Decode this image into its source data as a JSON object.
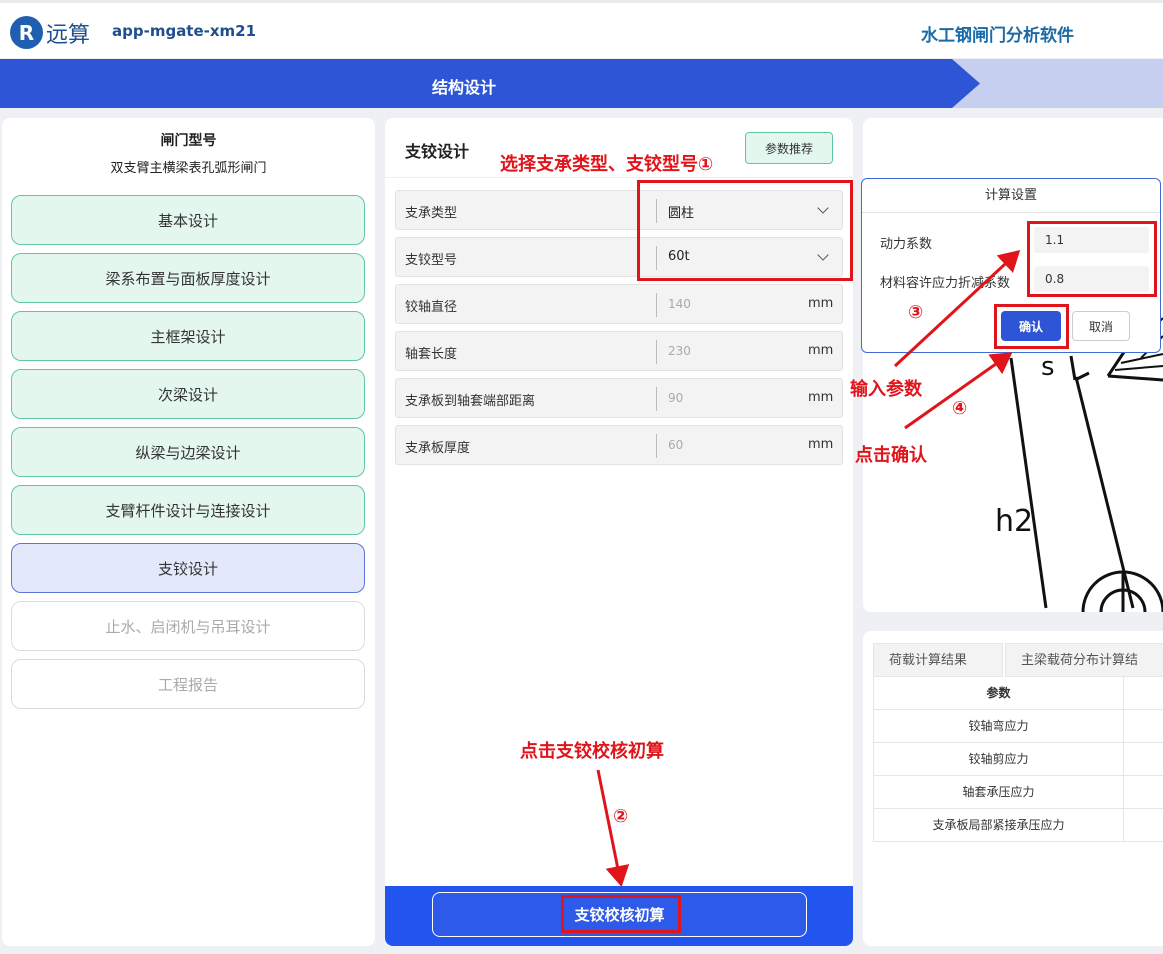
{
  "header": {
    "logo_mark": "R",
    "logo_text": "远算",
    "app_id": "app-mgate-xm21",
    "app_title": "水工钢闸门分析软件"
  },
  "stepbar": {
    "active_step": "结构设计"
  },
  "left": {
    "gate_type_label": "闸门型号",
    "gate_type_value": "双支臂主横梁表孔弧形闸门",
    "menu": [
      {
        "label": "基本设计",
        "state": "normal"
      },
      {
        "label": "梁系布置与面板厚度设计",
        "state": "normal"
      },
      {
        "label": "主框架设计",
        "state": "normal"
      },
      {
        "label": "次梁设计",
        "state": "normal"
      },
      {
        "label": "纵梁与边梁设计",
        "state": "normal"
      },
      {
        "label": "支臂杆件设计与连接设计",
        "state": "normal"
      },
      {
        "label": "支铰设计",
        "state": "active"
      },
      {
        "label": "止水、启闭机与吊耳设计",
        "state": "disabled"
      },
      {
        "label": "工程报告",
        "state": "disabled"
      }
    ]
  },
  "mid": {
    "title": "支铰设计",
    "recommend_label": "参数推荐",
    "fields": [
      {
        "label": "支承类型",
        "value": "圆柱",
        "kind": "select"
      },
      {
        "label": "支铰型号",
        "value": "60t",
        "kind": "select"
      },
      {
        "label": "铰轴直径",
        "value": "140",
        "unit": "mm",
        "kind": "readonly"
      },
      {
        "label": "轴套长度",
        "value": "230",
        "unit": "mm",
        "kind": "readonly"
      },
      {
        "label": "支承板到轴套端部距离",
        "value": "90",
        "unit": "mm",
        "kind": "readonly"
      },
      {
        "label": "支承板厚度",
        "value": "60",
        "unit": "mm",
        "kind": "readonly"
      }
    ],
    "calc_button": "支铰校核初算"
  },
  "dialog": {
    "title": "计算设置",
    "fields": [
      {
        "label": "动力系数",
        "value": "1.1"
      },
      {
        "label": "材料容许应力折减系数",
        "value": "0.8"
      }
    ],
    "ok": "确认",
    "cancel": "取消"
  },
  "drawing": {
    "label_s": "s",
    "label_h2": "h2"
  },
  "results": {
    "tabs": [
      "荷载计算结果",
      "主梁载荷分布计算结"
    ],
    "header": "参数",
    "rows": [
      "铰轴弯应力",
      "铰轴剪应力",
      "轴套承压应力",
      "支承板局部紧接承压应力"
    ]
  },
  "annotations": {
    "select": "选择支承类型、支铰型号①",
    "click_calc": "点击支铰校核初算",
    "step2": "②",
    "step3": "③",
    "input_params": "输入参数",
    "step4": "④",
    "click_ok": "点击确认"
  },
  "colors": {
    "accent": "#2d55d6",
    "annotation": "#e0151c",
    "menu_green": "#e4f7ef"
  }
}
